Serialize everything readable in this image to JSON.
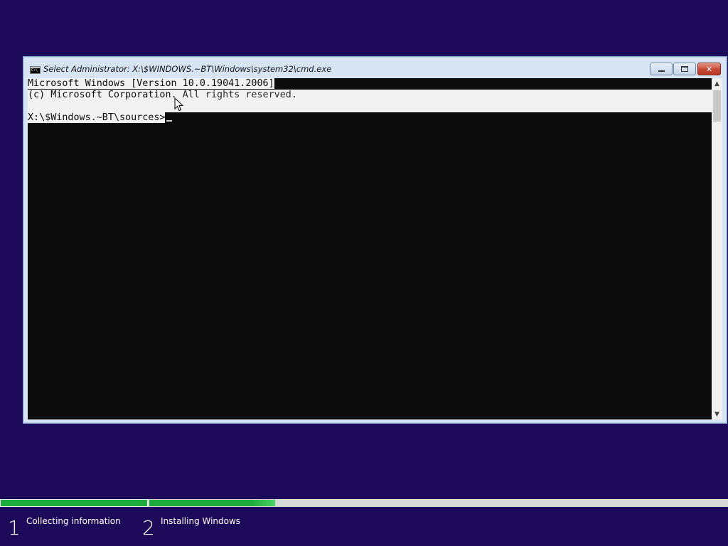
{
  "window": {
    "title": "Select Administrator: X:\\$WINDOWS.~BT\\Windows\\system32\\cmd.exe",
    "icon": "cmd-icon",
    "controls": {
      "minimize": "minimize-icon",
      "maximize": "maximize-icon",
      "close": "✕"
    }
  },
  "console": {
    "line1": "Microsoft Windows [Version 10.0.19041.2006]",
    "line2_selected": "(c) Microsoft Corporation",
    "line2_rest": ". All rights reserved.",
    "prompt": "X:\\$Windows.~BT\\sources>"
  },
  "scrollbar": {
    "up": "▲",
    "down": "▼"
  },
  "setup": {
    "steps": [
      {
        "number": "1",
        "label": "Collecting information",
        "progress": 1.0
      },
      {
        "number": "2",
        "label": "Installing Windows",
        "progress": 0.218
      }
    ]
  },
  "colors": {
    "background": "#1e0a5a",
    "progress_green": "#1dab3d",
    "console_bg": "#0c0c0c",
    "selection": "#f2f2f2"
  }
}
